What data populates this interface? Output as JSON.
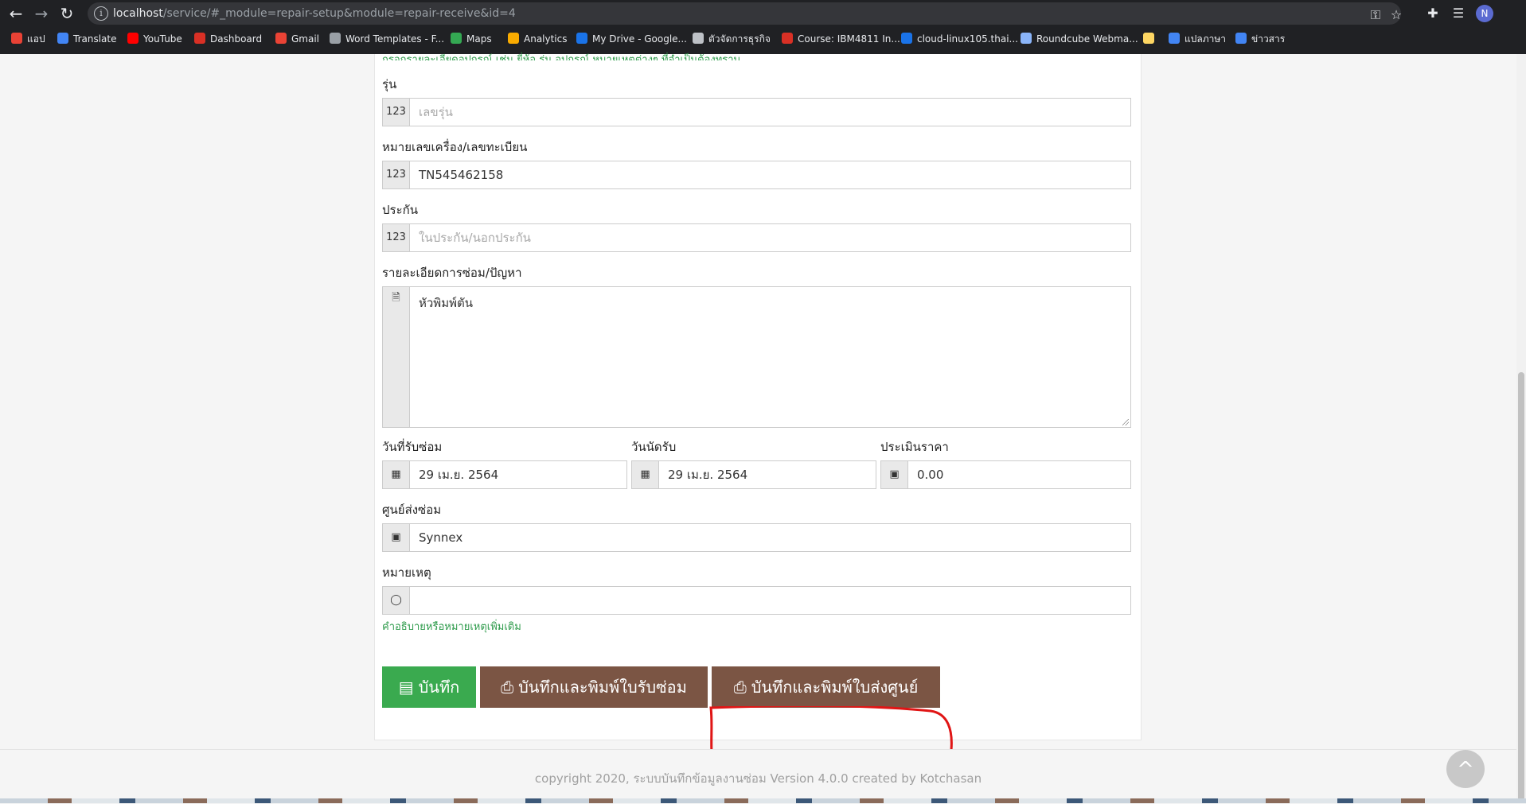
{
  "browser": {
    "url_host": "localhost",
    "url_path": "/service/#_module=repair-setup&module=repair-receive&id=4",
    "avatar_letter": "N",
    "bookmarks": [
      {
        "label": "แอป",
        "color": "#e94235"
      },
      {
        "label": "Translate",
        "color": "#4285f4"
      },
      {
        "label": "YouTube",
        "color": "#ff0000"
      },
      {
        "label": "Dashboard",
        "color": "#d93025"
      },
      {
        "label": "Gmail",
        "color": "#ea4335"
      },
      {
        "label": "Word Templates - F...",
        "color": "#9aa0a6"
      },
      {
        "label": "Maps",
        "color": "#34a853"
      },
      {
        "label": "Analytics",
        "color": "#f9ab00"
      },
      {
        "label": "My Drive - Google...",
        "color": "#1a73e8"
      },
      {
        "label": "ตัวจัดการธุรกิจ",
        "color": "#bdc1c6"
      },
      {
        "label": "Course: IBM4811 In...",
        "color": "#d93025"
      },
      {
        "label": "cloud-linux105.thai...",
        "color": "#1a73e8"
      },
      {
        "label": "Roundcube Webma...",
        "color": "#8ab4f8"
      },
      {
        "label": "",
        "color": "#fdd663"
      },
      {
        "label": "แปลภาษา",
        "color": "#4285f4"
      },
      {
        "label": "ข่าวสาร",
        "color": "#4285f4"
      }
    ]
  },
  "form": {
    "top_hint_cut": "กรอกรายละเอียดอุปกรณ์ เช่น ยี่ห้อ รุ่น อุปกรณ์ หมายเหตุต่างๆ ที่จำเป็นต้องทราบ",
    "model": {
      "label": "รุ่น",
      "placeholder": "เลขรุ่น"
    },
    "serial": {
      "label": "หมายเลขเครื่อง/เลขทะเบียน",
      "value": "TN545462158"
    },
    "warranty": {
      "label": "ประกัน",
      "placeholder": "ในประกัน/นอกประกัน"
    },
    "details": {
      "label": "รายละเอียดการซ่อม/ปัญหา",
      "value": "หัวพิมพ์ตัน"
    },
    "received_date": {
      "label": "วันที่รับซ่อม",
      "value": "29 เม.ย. 2564"
    },
    "pickup_date": {
      "label": "วันนัดรับ",
      "value": "29 เม.ย. 2564"
    },
    "estimate": {
      "label": "ประเมินราคา",
      "value": "0.00"
    },
    "service_center": {
      "label": "ศูนย์ส่งซ่อม",
      "value": "Synnex"
    },
    "note": {
      "label": "หมายเหตุ",
      "value": "",
      "hint": "คำอธิบายหรือหมายเหตุเพิ่มเติม"
    }
  },
  "buttons": {
    "save": "บันทึก",
    "save_print_receipt": "บันทึกและพิมพ์ใบรับซ่อม",
    "save_print_center": "บันทึกและพิมพ์ใบส่งศูนย์"
  },
  "footer": {
    "copyright": "copyright 2020, ระบบบันทึกข้อมูลงานซ่อม Version 4.0.0 created by Kotchasan"
  },
  "colors": {
    "save_button": "#3aaa4f",
    "print_button": "#7b5544",
    "highlight_annotation": "#e01515",
    "hint_text": "#2e9b4b"
  }
}
